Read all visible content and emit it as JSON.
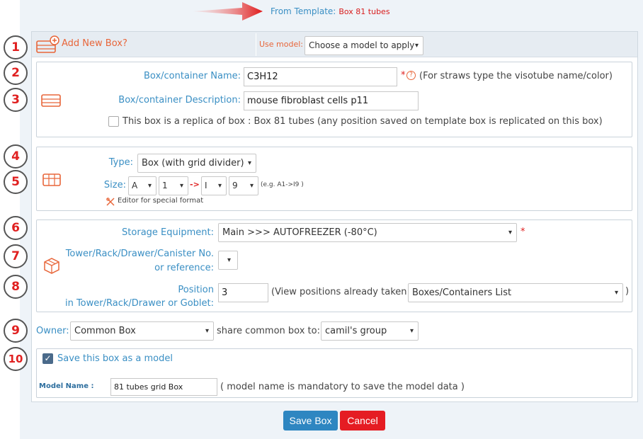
{
  "template": {
    "label": "From Template:",
    "value": "Box 81 tubes"
  },
  "header": {
    "add_new_box": "Add New Box?",
    "use_model_label": "Use model:",
    "model_select": "Choose a model to apply"
  },
  "steps": [
    "1",
    "2",
    "3",
    "4",
    "5",
    "6",
    "7",
    "8",
    "9",
    "10"
  ],
  "name_section": {
    "name_label": "Box/container Name:",
    "name_value": "C3H12",
    "required_star": "*",
    "help_glyph": "?",
    "name_hint": "(For straws type the visotube name/color)",
    "description_label": "Box/container Description:",
    "description_value": "mouse fibroblast cells p11",
    "replica_text": "This box is a replica of box : Box 81 tubes (any position saved on template box is replicated on this box)"
  },
  "type_section": {
    "type_label": "Type:",
    "type_value": "Box (with grid divider)",
    "size_label": "Size:",
    "size_from_row": "A",
    "size_from_col": "1",
    "size_arrow": "->",
    "size_to_row": "I",
    "size_to_col": "9",
    "size_example": "(e.g. A1->I9 )",
    "editor_link": "Editor for special format"
  },
  "storage_section": {
    "equipment_label": "Storage Equipment:",
    "equipment_value": "Main >>> AUTOFREEZER (-80°C)",
    "required_star": "*",
    "tower_label_line1": "Tower/Rack/Drawer/Canister No.",
    "tower_label_line2": "or reference:",
    "tower_value": "",
    "position_label_line1": "Position",
    "position_label_line2": "in Tower/Rack/Drawer or Goblet:",
    "position_value": "3",
    "view_positions_text": "(View positions already taken:",
    "positions_select": "Boxes/Containers List",
    "close_paren": ")"
  },
  "owner_row": {
    "owner_label": "Owner:",
    "owner_value": "Common Box",
    "share_label": "share common box to:",
    "share_value": "camil's group"
  },
  "model_section": {
    "save_as_model_text": "Save this box as a model",
    "model_name_label": "Model Name :",
    "model_name_value": "81 tubes grid Box",
    "model_name_hint": "( model name is mandatory to save the model data )"
  },
  "buttons": {
    "save": "Save Box",
    "cancel": "Cancel"
  },
  "colors": {
    "accent": "#3a8fc4",
    "danger": "#e51c23",
    "primary": "#2e86c1",
    "icon": "#e8663a"
  },
  "icons": {
    "select_caret": "▾",
    "checkmark": "✓"
  }
}
